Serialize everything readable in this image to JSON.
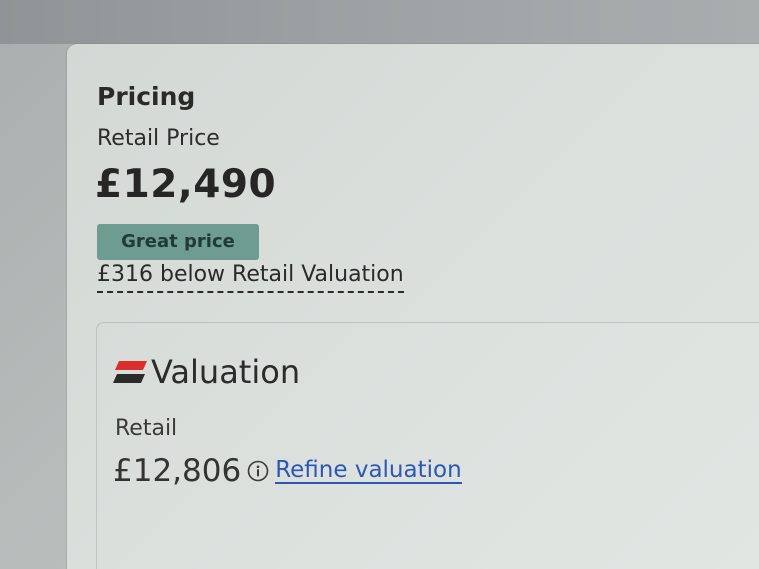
{
  "pricing": {
    "title": "Pricing",
    "retail_price_label": "Retail Price",
    "retail_price_value": "£12,490",
    "badge": "Great price",
    "below_valuation": "£316 below Retail Valuation"
  },
  "valuation": {
    "logo_text": "Valuation",
    "logo_icon": "valuation-logo-mark",
    "retail_label": "Retail",
    "retail_value": "£12,806",
    "info_icon": "info-icon",
    "refine_link": "Refine valuation"
  },
  "colors": {
    "badge_bg": "#6f9c91",
    "link": "#2b58b5",
    "logo_red": "#d9302e",
    "logo_dark": "#2b2b2b"
  }
}
